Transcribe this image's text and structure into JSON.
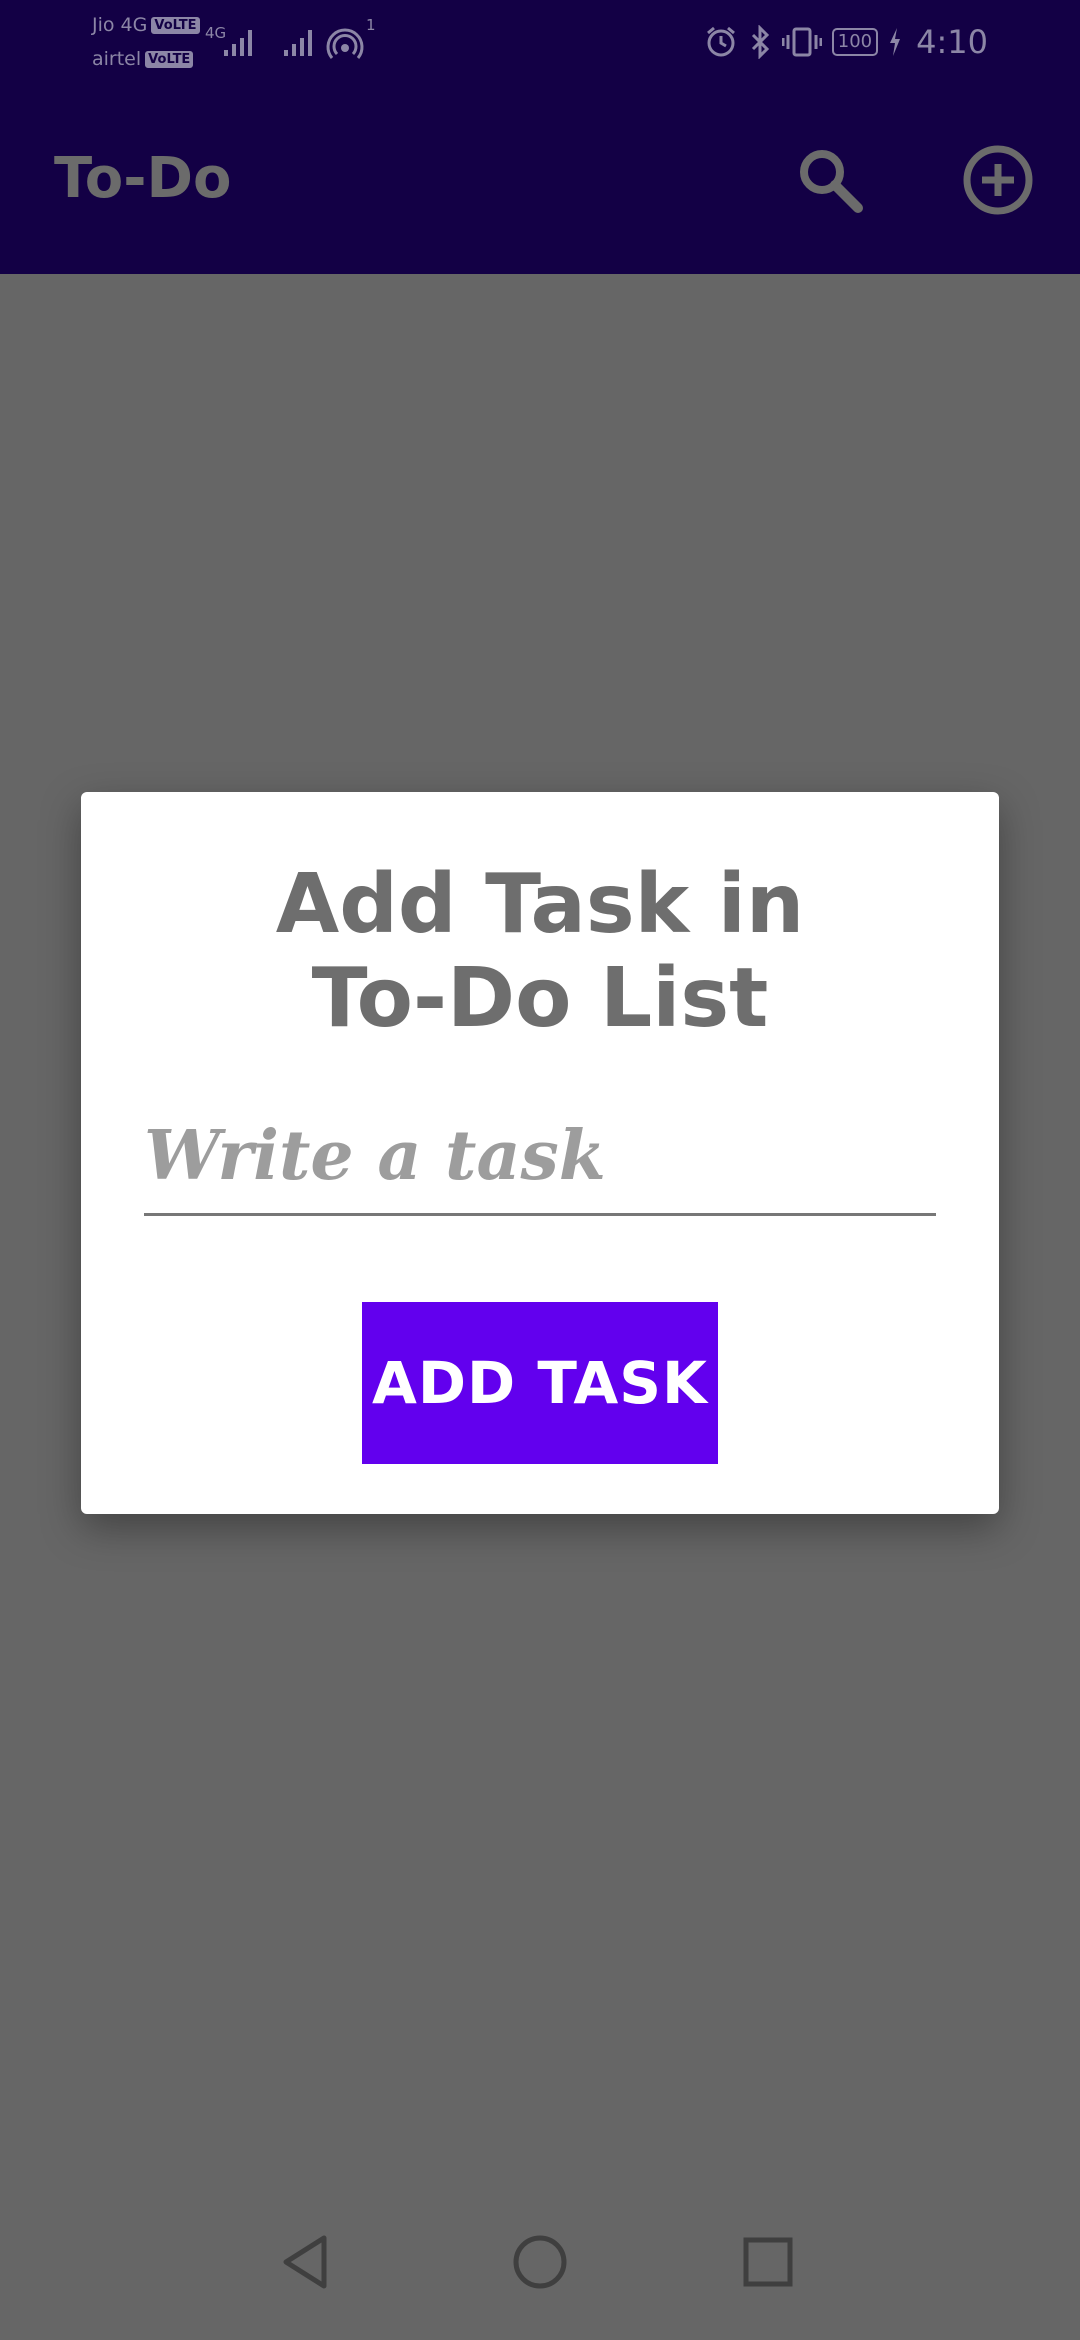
{
  "status_bar": {
    "carrier1": "Jio 4G",
    "carrier2": "airtel",
    "volte": "VoLTE",
    "network_type": "4G",
    "hotspot_count": "1",
    "battery": "100",
    "time": "4:10"
  },
  "app_bar": {
    "title": "To-Do",
    "search_icon": "search-icon",
    "add_icon": "add-circle-icon"
  },
  "dialog": {
    "title_line1": "Add Task in",
    "title_line2": "To-Do List",
    "input_placeholder": "Write a task",
    "input_value": "",
    "button_label": "ADD TASK"
  },
  "nav_bar": {
    "back_icon": "back-icon",
    "home_icon": "home-icon",
    "recents_icon": "recents-icon"
  },
  "colors": {
    "app_bar": "#130045",
    "scrim": "#666666",
    "button": "#6200ee"
  }
}
